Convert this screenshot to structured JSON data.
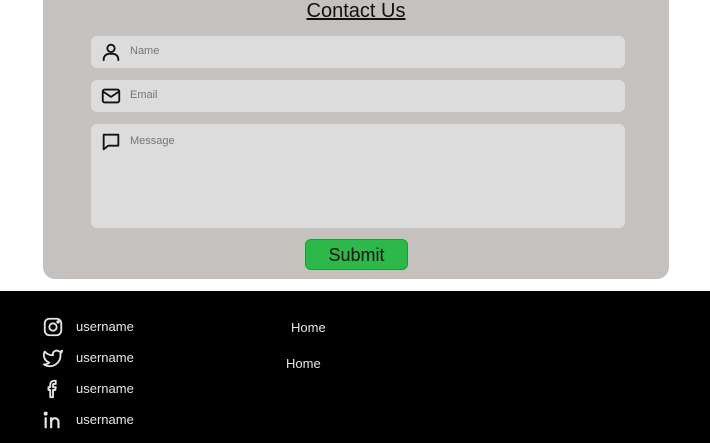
{
  "contact": {
    "title": "Contact Us",
    "name_placeholder": "Name",
    "email_placeholder": "Email",
    "message_placeholder": "Message",
    "submit_label": "Submit"
  },
  "footer": {
    "social": [
      {
        "icon": "instagram-icon",
        "username": "username"
      },
      {
        "icon": "twitter-icon",
        "username": "username"
      },
      {
        "icon": "facebook-icon",
        "username": "username"
      },
      {
        "icon": "linkedin-icon",
        "username": "username"
      }
    ],
    "nav": [
      {
        "label": "Home"
      },
      {
        "label": "Home"
      }
    ]
  },
  "colors": {
    "card_background": "#c4c1bf",
    "field_background": "#dcdcdc",
    "submit_green": "#2db84a",
    "footer_background": "#000000",
    "footer_text": "#e6e6e6"
  }
}
